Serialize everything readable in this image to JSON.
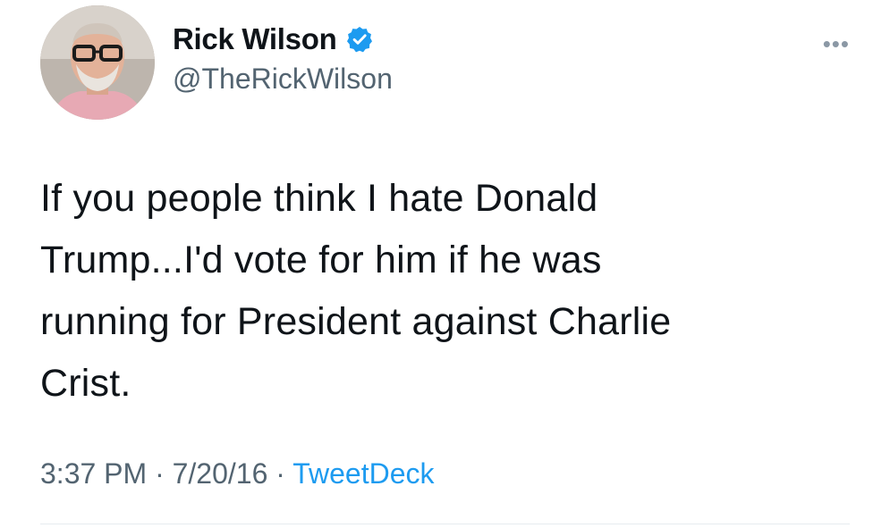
{
  "author": {
    "display_name": "Rick Wilson",
    "handle": "@TheRickWilson",
    "verified_icon": "verified-badge-icon",
    "avatar_icon": "profile-photo"
  },
  "more_icon": "more-options-icon",
  "more_glyph": "•••",
  "tweet": {
    "lines": [
      "If you people think I hate Donald",
      "Trump...I'd vote for him if he was",
      "running for President against Charlie",
      "Crist."
    ]
  },
  "meta": {
    "time": "3:37 PM",
    "date": "7/20/16",
    "separator": " · ",
    "source": "TweetDeck"
  },
  "colors": {
    "text": "#0f1419",
    "secondary": "#536471",
    "accent": "#1d9bf0"
  }
}
